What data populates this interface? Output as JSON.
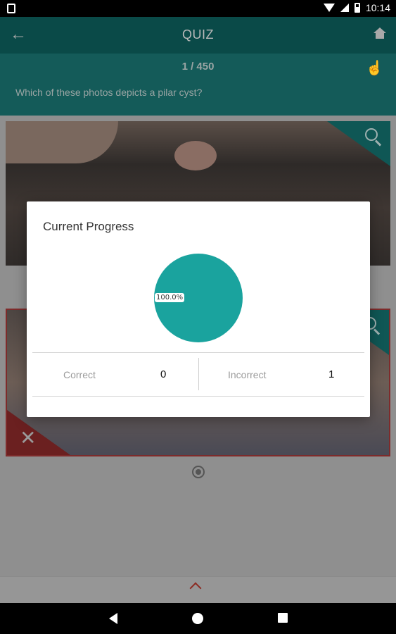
{
  "status_bar": {
    "time": "10:14"
  },
  "app_bar": {
    "title": "QUIZ"
  },
  "quiz": {
    "counter": "1 / 450",
    "question": "Which of these photos depicts a pilar cyst?"
  },
  "dialog": {
    "title": "Current Progress",
    "pie_label": "100.0%",
    "pie_fraction": 1.0,
    "pie_color": "#1aa39e",
    "correct_label": "Correct",
    "correct_value": "0",
    "incorrect_label": "Incorrect",
    "incorrect_value": "1"
  },
  "colors": {
    "accent": "#1aa39e",
    "wrong": "#d93a3a"
  }
}
